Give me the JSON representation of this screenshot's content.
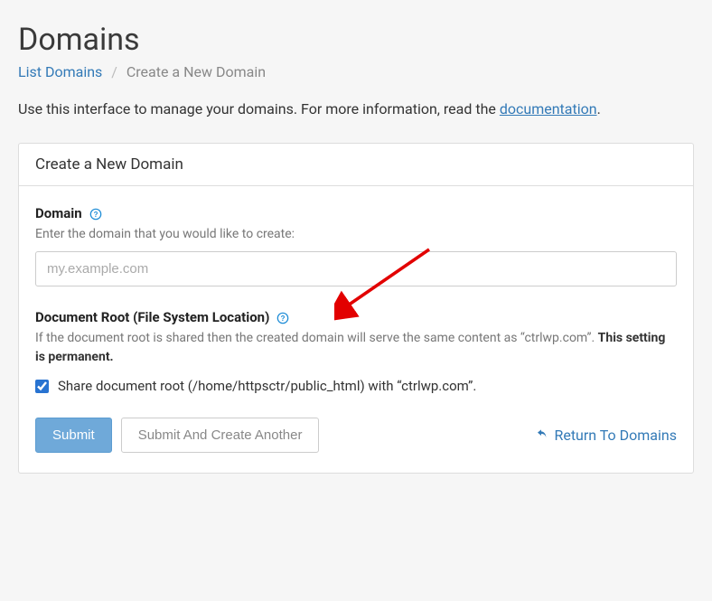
{
  "header": {
    "title": "Domains"
  },
  "breadcrumb": {
    "list_label": "List Domains",
    "current": "Create a New Domain"
  },
  "intro": {
    "text_prefix": "Use this interface to manage your domains. For more information, read the ",
    "link_text": "documentation",
    "text_suffix": "."
  },
  "panel": {
    "heading": "Create a New Domain"
  },
  "domain_field": {
    "label": "Domain",
    "hint": "Enter the domain that you would like to create:",
    "placeholder": "my.example.com",
    "value": ""
  },
  "docroot_field": {
    "label": "Document Root (File System Location)",
    "hint_prefix": "If the document root is shared then the created domain will serve the same content as “ctrlwp.com”. ",
    "hint_bold": "This setting is permanent."
  },
  "share_checkbox": {
    "label": "Share document root (/home/httpsctr/public_html) with “ctrlwp.com”.",
    "checked": true
  },
  "buttons": {
    "submit": "Submit",
    "submit_another": "Submit And Create Another",
    "return": "Return To Domains"
  }
}
